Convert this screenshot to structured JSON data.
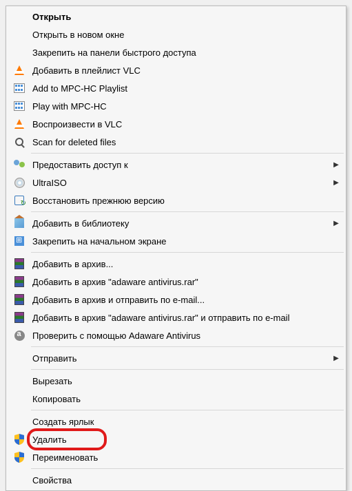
{
  "menu": {
    "open": "Открыть",
    "open_new_window": "Открыть в новом окне",
    "pin_quick_access": "Закрепить на панели быстрого доступа",
    "add_vlc_playlist": "Добавить в плейлист VLC",
    "add_mpc_playlist": "Add to MPC-HC Playlist",
    "play_mpc": "Play with MPC-HC",
    "play_vlc": "Воспроизвести в VLC",
    "scan_deleted": "Scan for deleted files",
    "give_access_to": "Предоставить доступ к",
    "ultraiso": "UltraISO",
    "restore_previous": "Восстановить прежнюю версию",
    "add_to_library": "Добавить в библиотеку",
    "pin_start": "Закрепить на начальном экране",
    "add_to_archive": "Добавить в архив...",
    "add_to_archive_named": "Добавить в архив \"adaware antivirus.rar\"",
    "add_archive_email": "Добавить в архив и отправить по e-mail...",
    "add_archive_named_email": "Добавить в архив \"adaware antivirus.rar\" и отправить по e-mail",
    "check_adaware": "Проверить с помощью Adaware Antivirus",
    "send_to": "Отправить",
    "cut": "Вырезать",
    "copy": "Копировать",
    "create_shortcut": "Создать ярлык",
    "delete": "Удалить",
    "rename": "Переименовать",
    "properties": "Свойства"
  },
  "glyphs": {
    "submenu_arrow": "▶"
  },
  "highlight": "delete"
}
